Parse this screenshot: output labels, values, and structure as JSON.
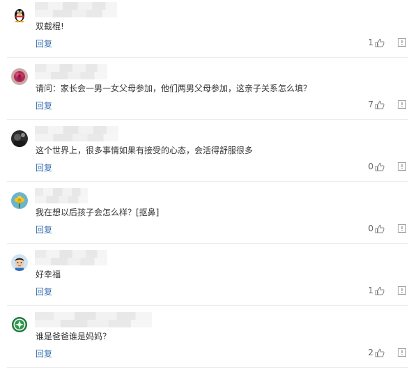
{
  "reply_label": "回复",
  "colors": {
    "link": "#3a6fb0",
    "text": "#333333",
    "muted": "#888888"
  },
  "comments": [
    {
      "avatar": "penguin-avatar",
      "text": "双截棍!",
      "likes": "1"
    },
    {
      "avatar": "flower-avatar",
      "text": "请问：家长会一男一女父母参加，他们两男父母参加，这亲子关系怎么填？",
      "likes": "7"
    },
    {
      "avatar": "dark-photo-avatar",
      "text": "这个世界上，很多事情如果有接受的心态，会活得舒服很多",
      "likes": "0"
    },
    {
      "avatar": "yellow-flower-avatar",
      "text": "我在想以后孩子会怎么样？[抠鼻]",
      "likes": "0"
    },
    {
      "avatar": "boy-avatar",
      "text": "好幸福",
      "likes": "1"
    },
    {
      "avatar": "green-logo-avatar",
      "text": "谁是爸爸谁是妈妈？",
      "likes": "2"
    }
  ]
}
